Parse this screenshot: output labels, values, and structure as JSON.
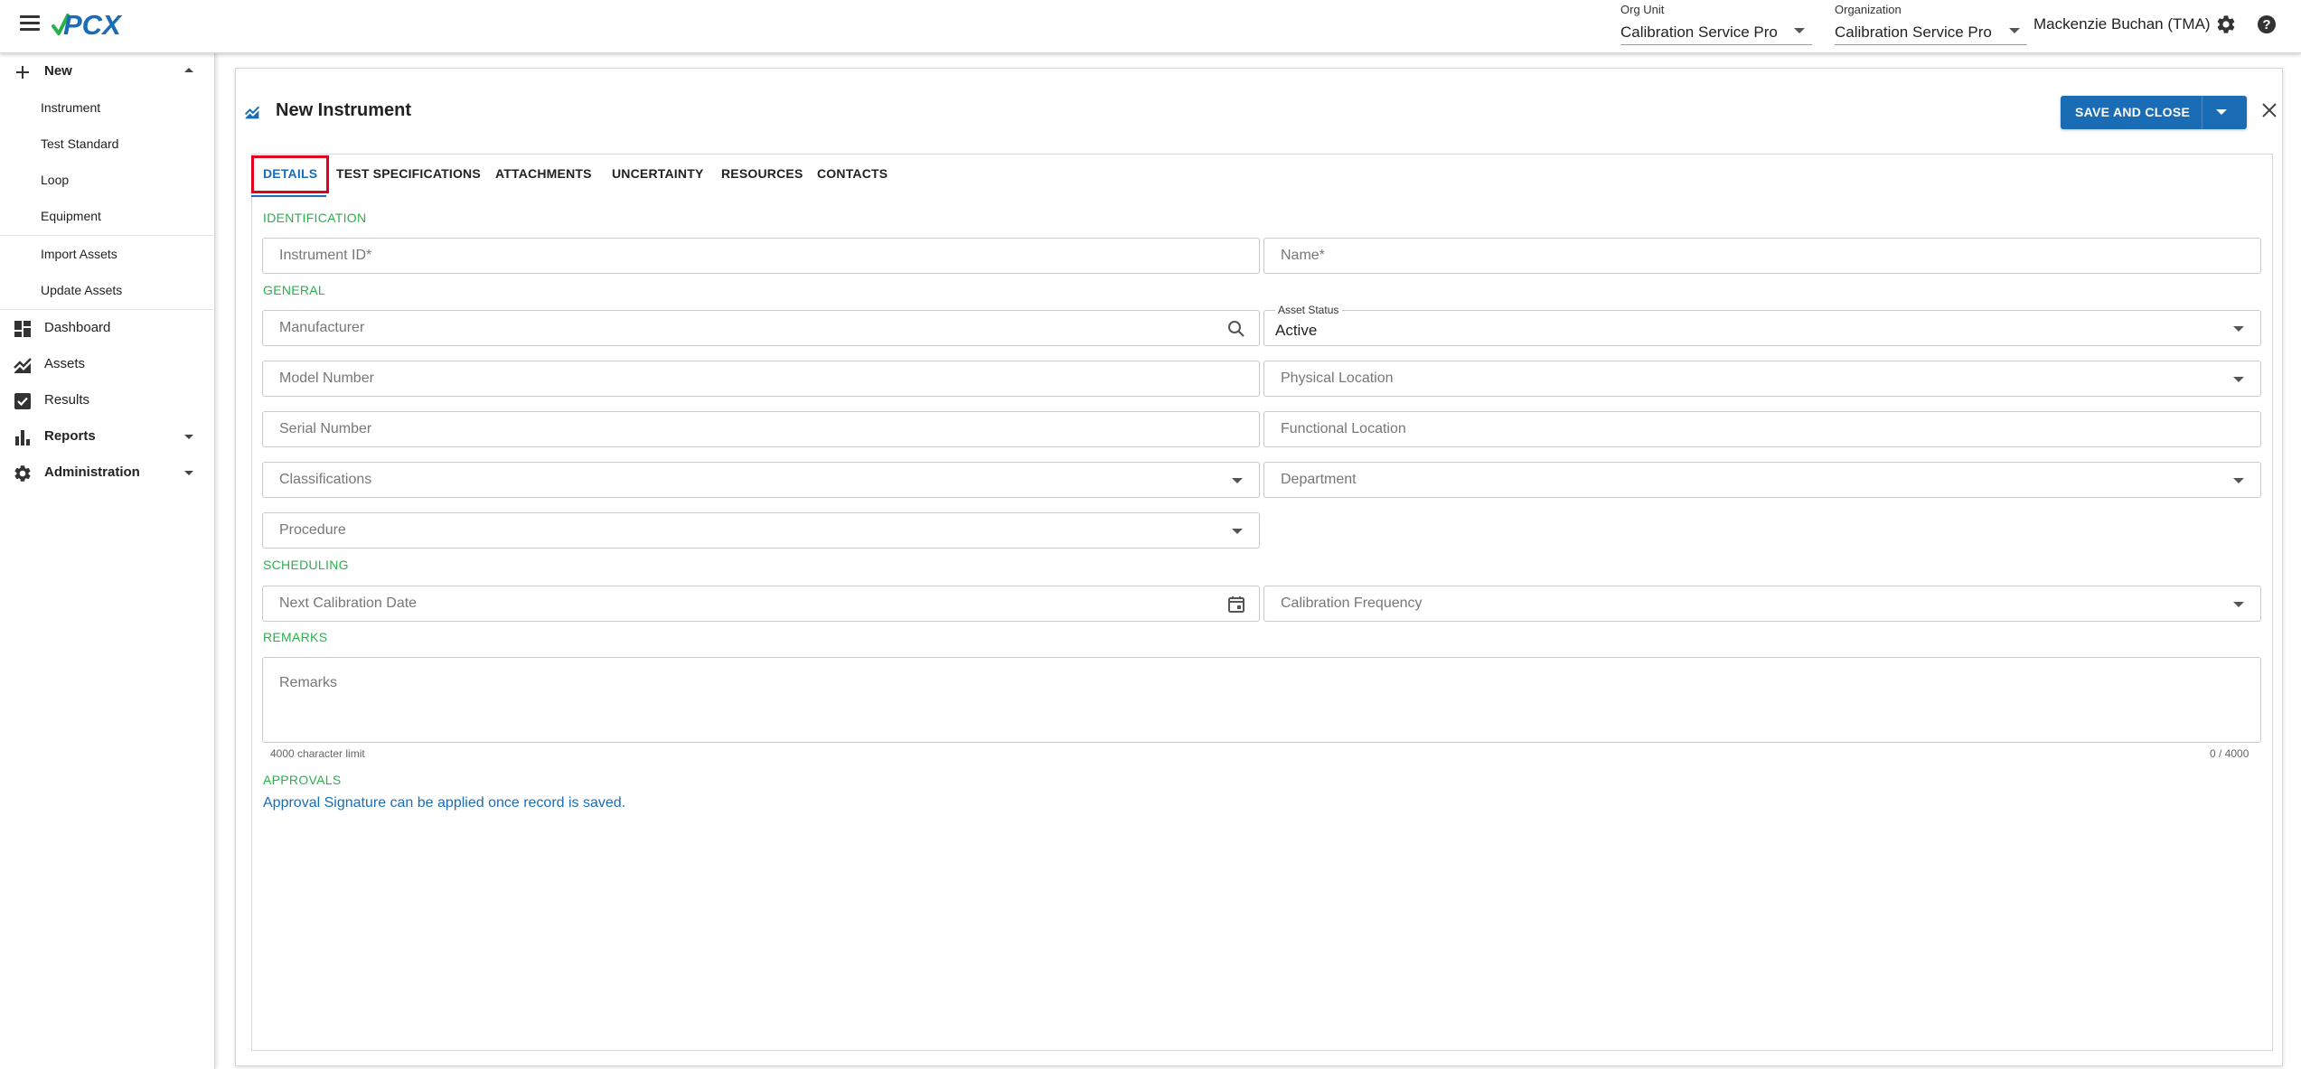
{
  "app": {
    "logo_text": "PCX",
    "colors": {
      "primary": "#1a6db5",
      "section": "#27b24a",
      "highlight": "#e0001b"
    }
  },
  "topbar": {
    "org_unit": {
      "label": "Org Unit",
      "value": "Calibration Service Pro"
    },
    "organization": {
      "label": "Organization",
      "value": "Calibration Service Pro"
    },
    "user_name": "Mackenzie Buchan (TMA)",
    "icons": [
      "menu-icon",
      "settings-icon",
      "help-icon"
    ]
  },
  "sidebar": {
    "new_label": "New",
    "new_items": [
      "Instrument",
      "Test Standard",
      "Loop",
      "Equipment"
    ],
    "asset_actions": [
      "Import Assets",
      "Update Assets"
    ],
    "nav": {
      "dashboard": "Dashboard",
      "assets": "Assets",
      "results": "Results",
      "reports": "Reports",
      "administration": "Administration"
    }
  },
  "page": {
    "title": "New Instrument",
    "save_label": "SAVE AND CLOSE"
  },
  "tabs": [
    "DETAILS",
    "TEST SPECIFICATIONS",
    "ATTACHMENTS",
    "UNCERTAINTY",
    "RESOURCES",
    "CONTACTS"
  ],
  "active_tab": "DETAILS",
  "sections": {
    "identification": "IDENTIFICATION",
    "general": "GENERAL",
    "scheduling": "SCHEDULING",
    "remarks": "REMARKS",
    "approvals": "APPROVALS"
  },
  "fields": {
    "instrument_id": "Instrument ID*",
    "name": "Name*",
    "manufacturer": "Manufacturer",
    "asset_status_label": "Asset Status",
    "asset_status_value": "Active",
    "model_number": "Model Number",
    "physical_location": "Physical Location",
    "serial_number": "Serial Number",
    "functional_location": "Functional Location",
    "classifications": "Classifications",
    "department": "Department",
    "procedure": "Procedure",
    "next_calibration_date": "Next Calibration Date",
    "calibration_frequency": "Calibration Frequency",
    "remarks": "Remarks",
    "remarks_limit": "4000 character limit",
    "remarks_count": "0 / 4000"
  },
  "approvals": {
    "note": "Approval Signature can be applied once record is saved."
  }
}
